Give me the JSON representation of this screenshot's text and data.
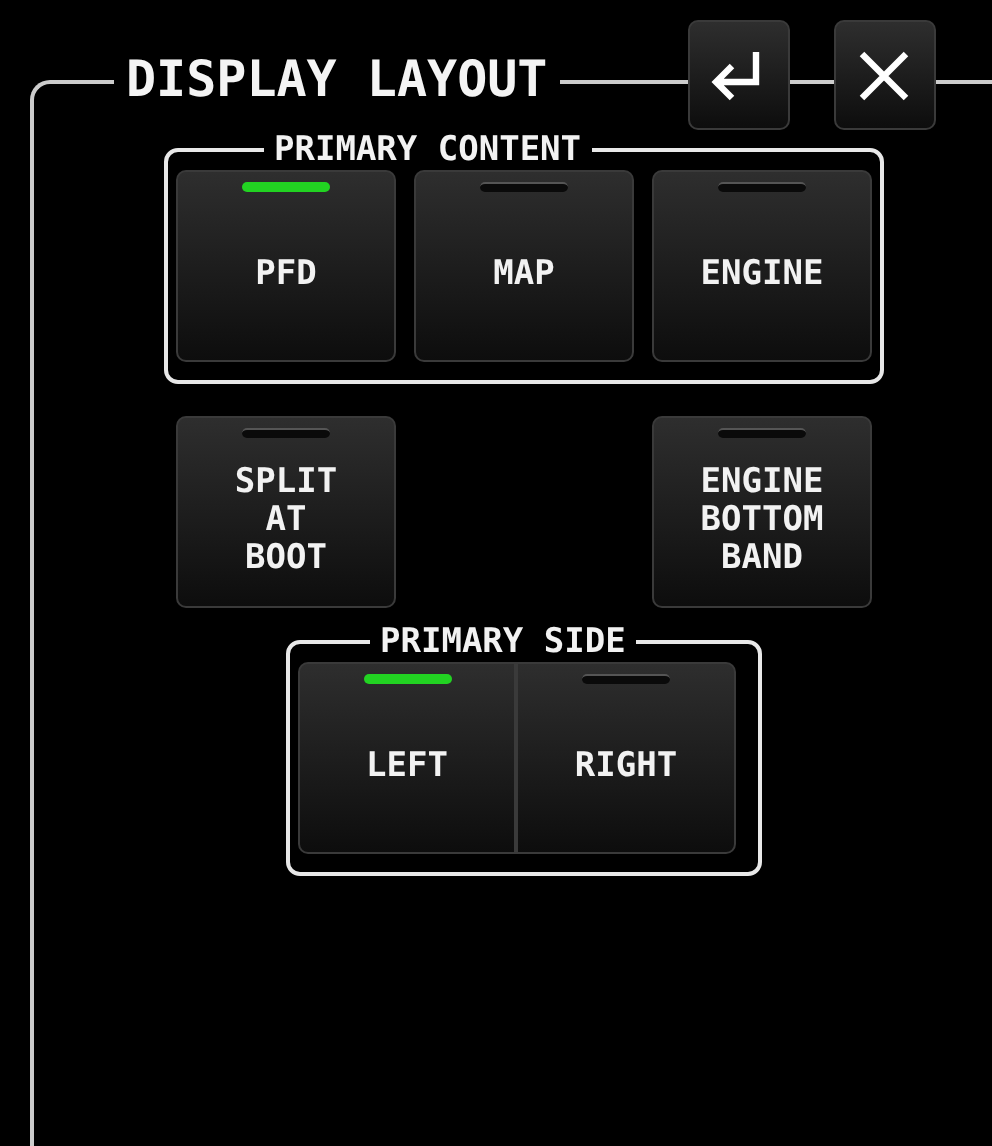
{
  "title": "DISPLAY LAYOUT",
  "header_buttons": [
    {
      "kind": "enter"
    },
    {
      "kind": "close"
    }
  ],
  "primary_content": {
    "label": "PRIMARY CONTENT",
    "buttons": [
      {
        "label": "PFD",
        "selected": true
      },
      {
        "label": "MAP",
        "selected": false
      },
      {
        "label": "ENGINE",
        "selected": false
      }
    ]
  },
  "options": [
    {
      "label": "SPLIT\nAT\nBOOT",
      "on": false
    },
    {
      "label": "ENGINE\nBOTTOM\nBAND",
      "on": false
    }
  ],
  "primary_side": {
    "label": "PRIMARY SIDE",
    "buttons": [
      {
        "label": "LEFT",
        "selected": true
      },
      {
        "label": "RIGHT",
        "selected": false
      }
    ]
  }
}
